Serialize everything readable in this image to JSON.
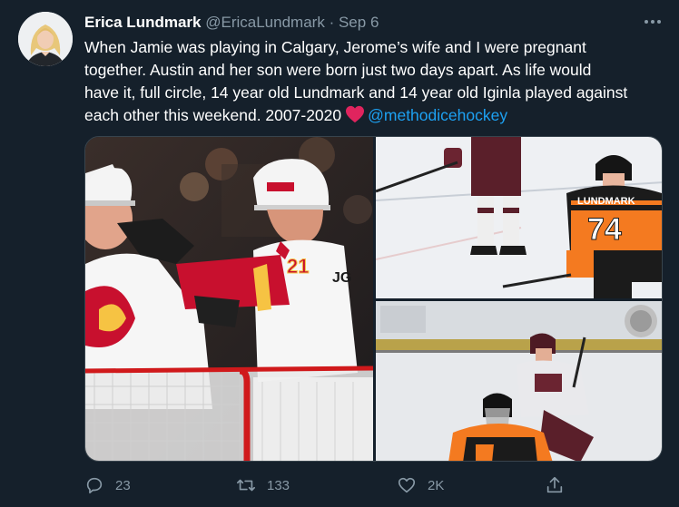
{
  "tweet": {
    "author": {
      "display_name": "Erica Lundmark",
      "handle": "@EricaLundmark",
      "separator": "·",
      "date": "Sep 6"
    },
    "text_lines": [
      "When Jamie was playing in Calgary, Jerome’s wife and I were pregnant",
      "together. Austin and her son were born just two days apart. As life would",
      "have it, full circle, 14 year old Lundmark and 14 year old Iginla played against",
      "each other this weekend. 2007-2020"
    ],
    "mention": "@methodicehockey",
    "emoji_icon": "red-heart-icon",
    "photos": [
      {
        "jersey_text": "JG",
        "number_text": "21"
      },
      {
        "jersey_text": "LUNDMARK",
        "number_text": "74"
      },
      {}
    ],
    "stats": {
      "replies": "23",
      "retweets": "133",
      "likes": "2K"
    }
  },
  "icons": {
    "more": "more-horizontal-icon",
    "reply": "reply-bubble-icon",
    "retweet": "retweet-arrows-icon",
    "like": "heart-outline-icon",
    "share": "share-upload-icon"
  },
  "colors": {
    "background": "#15202b",
    "text": "#ffffff",
    "secondary": "#8899a6",
    "link": "#1da1f2",
    "heart": "#e0245e",
    "flames_red": "#c8102e",
    "flyers_orange": "#f47a20"
  }
}
